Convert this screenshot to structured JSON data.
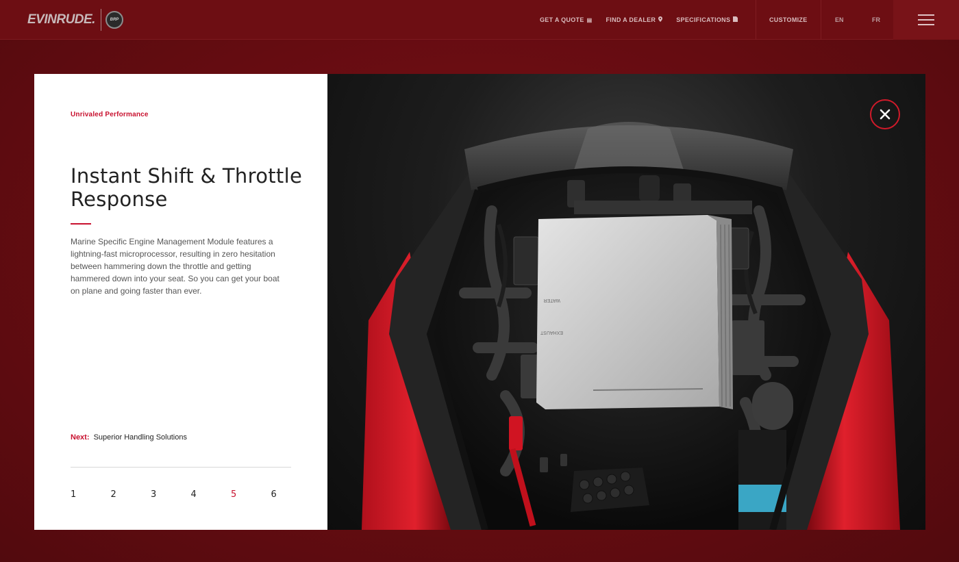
{
  "brand": {
    "logo_text": "EVINRUDE.",
    "badge_text": "BRP"
  },
  "nav": {
    "links": [
      {
        "label": "GET A QUOTE",
        "icon": "document-icon"
      },
      {
        "label": "FIND A DEALER",
        "icon": "map-pin-icon"
      },
      {
        "label": "SPECIFICATIONS",
        "icon": "file-icon"
      }
    ],
    "customize": "CUSTOMIZE",
    "lang_en": "EN",
    "lang_fr": "FR",
    "menu_icon": "hamburger-menu-icon"
  },
  "feature": {
    "eyebrow": "Unrivaled Performance",
    "title": "Instant Shift & Throttle Response",
    "body": "Marine Specific Engine Management Module features a lightning-fast microprocessor, resulting in zero hesitation between hammering down the throttle and getting hammered down into your seat. So you can get your boat on plane and going faster than ever.",
    "next_label": "Next:",
    "next_title": "Superior Handling Solutions",
    "pages": [
      "1",
      "2",
      "3",
      "4",
      "5",
      "6"
    ],
    "active_page": 5
  },
  "colors": {
    "accent": "#c8102e",
    "background": "#6a0d12"
  },
  "close_icon": "close-icon"
}
